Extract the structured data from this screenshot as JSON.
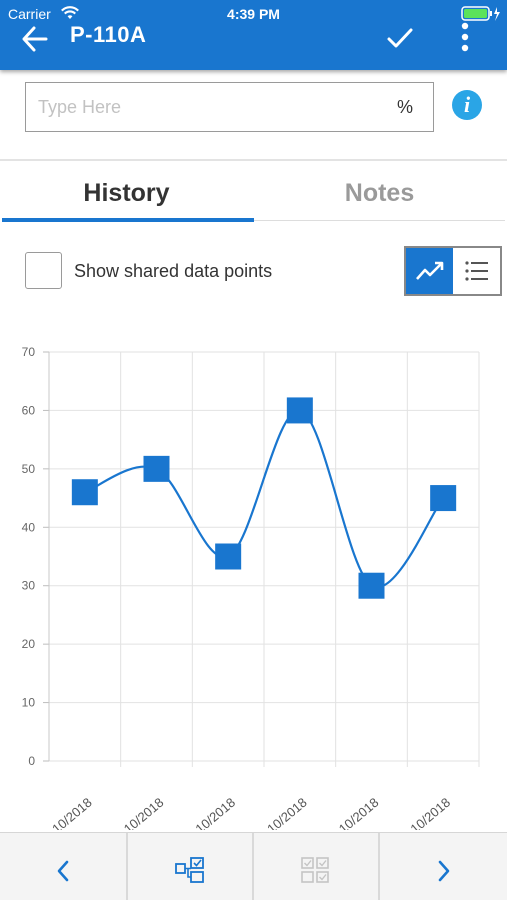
{
  "status_bar": {
    "carrier": "Carrier",
    "time": "4:39 PM"
  },
  "header": {
    "title": "P-110A",
    "color": "#1976cf",
    "back_icon": "arrow-left-icon",
    "confirm_icon": "checkmark-icon",
    "more_icon": "vertical-ellipsis-icon"
  },
  "input": {
    "placeholder": "Type Here",
    "value": "",
    "unit": "%",
    "info_icon": "info-icon"
  },
  "tabs": [
    {
      "label": "History",
      "active": true
    },
    {
      "label": "Notes",
      "active": false
    }
  ],
  "options": {
    "shared_checkbox_label": "Show shared data points",
    "shared_checked": false,
    "view_toggle": {
      "chart_icon": "trend-chart-icon",
      "list_icon": "list-icon",
      "selected": "chart"
    }
  },
  "chart_data": {
    "type": "line",
    "x": [
      "10/2018",
      "10/2018",
      "10/2018",
      "10/2018",
      "10/2018",
      "10/2018"
    ],
    "series": [
      {
        "values": [
          46,
          50,
          35,
          60,
          30,
          45
        ],
        "color": "#1976cf"
      }
    ],
    "yticks": [
      0,
      10,
      20,
      30,
      40,
      50,
      60,
      70
    ],
    "ylim": [
      0,
      70
    ],
    "grid": true,
    "marker": "square",
    "curve": "smooth"
  },
  "bottom_bar": {
    "previous_icon": "chevron-left-icon",
    "link_icon": "linked-checklist-icon",
    "checklist_icon": "checklist-grid-icon",
    "next_icon": "chevron-right-icon"
  }
}
